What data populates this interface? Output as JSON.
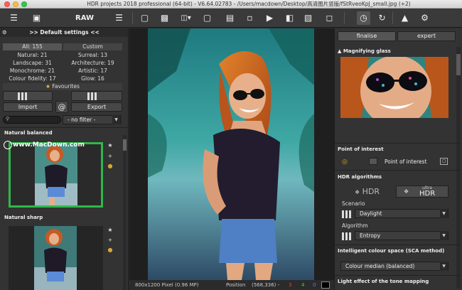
{
  "window": {
    "title": "HDR projects 2018 professional (64-bit) - V6.64.02783 - /Users/macdown/Desktop/高清图片竖版/fStRveoKpJ_small.jpg (+2)"
  },
  "toolbar": {
    "raw_label": "RAW",
    "icons": [
      "layers-icon",
      "film-icon",
      "raw-icon",
      "sliders-icon",
      "page-icon",
      "save-icon",
      "print-icon",
      "export-icon",
      "compare-icon",
      "crop-icon",
      "play-icon",
      "transform-icon",
      "split-icon",
      "fullscreen-icon",
      "window-icon",
      "history-icon",
      "redo-icon",
      "mirror-icon",
      "settings-icon"
    ]
  },
  "presets": {
    "header": ">> Default settings <<",
    "all_label": "All: 155",
    "custom_label": "Custom",
    "categories": [
      "Natural: 21",
      "Surreal: 13",
      "Landscape: 31",
      "Architecture: 19",
      "Monochrome: 21",
      "Artistic: 17",
      "Colour fidelity: 17",
      "Glow: 16"
    ],
    "favourites_label": "Favourites",
    "import_label": "Import",
    "export_label": "Export",
    "filter_value": "- no filter -",
    "thumbnails": [
      {
        "label": "Natural balanced",
        "watermark": "www.MacDown.com"
      },
      {
        "label": "Natural sharp"
      }
    ]
  },
  "status": {
    "dimensions": "800x1200 Pixel (0.96 MP)",
    "position_label": "Position",
    "position_value": "(568,336) -",
    "r": "3",
    "g": "4",
    "b": "0",
    "r_color": "#e04040",
    "g_color": "#40d040",
    "b_color": "#5a7aff"
  },
  "right_panel": {
    "finalise_label": "finalise",
    "expert_label": "expert",
    "magnifier_label": "Magnifying glass",
    "poi_label": "Point of interest",
    "poi_button_label": "Point of interest",
    "hdr_algorithms_label": "HDR algorithms",
    "hdr_label": "HDR",
    "ultra_label": "ultra",
    "ultra_hdr_label": "HDR",
    "scenario_label": "Scenario",
    "scenario_value": "Daylight",
    "algorithm_label": "Algorithm",
    "algorithm_value": "Entropy",
    "sca_label": "Intelligent colour space (SCA method)",
    "sca_value": "Colour median (balanced)",
    "tone_label": "Light effect of the tone mapping"
  },
  "colors": {
    "accent_green": "#2fb84a",
    "panel": "#333333",
    "toolbar": "#3a3a3a"
  }
}
